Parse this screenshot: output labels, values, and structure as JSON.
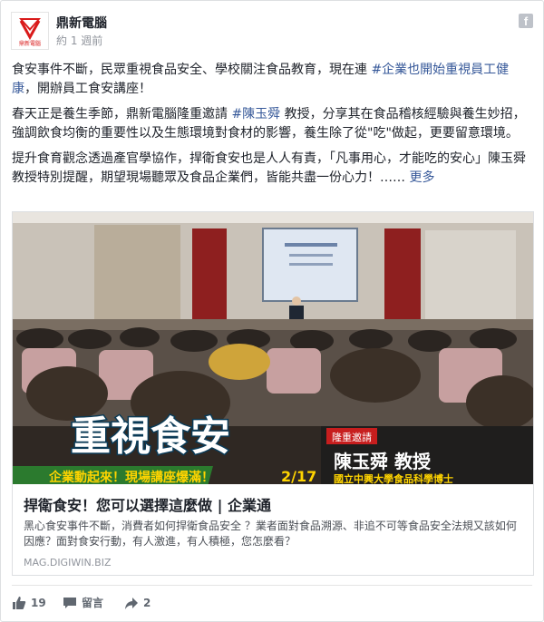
{
  "page": {
    "name": "鼎新電腦",
    "time": "約 1 週前",
    "logo_text": "鼎新電腦"
  },
  "post": {
    "p1_pre": "食安事件不斷，民眾重視食品安全、學校關注食品教育，現在連 ",
    "p1_hashtag": "#企業也開始重視員工健康",
    "p1_post": "，開辦員工食安講座！",
    "p2_pre": "春天正是養生季節，鼎新電腦隆重邀請 ",
    "p2_hashtag": "#陳玉舜",
    "p2_post": " 教授，分享其在食品稽核經驗與養生妙招，強調飲食均衡的重要性以及生態環境對食材的影響，養生除了從\"吃\"做起，更要留意環境。",
    "p3": "提升食育觀念透過產官學協作，捍衛食安也是人人有責，「凡事用心，才能吃的安心」陳玉舜教授特別提醒，期望現場聽眾及食品企業們，皆能共盡一份心力！…… ",
    "more_label": "更多"
  },
  "link_preview": {
    "image": {
      "headline": "重視食安",
      "banner": "企業動起來！現場講座爆滿！",
      "date": "2/17",
      "badge": "隆重邀請",
      "speaker": "陳玉舜 教授",
      "affiliation": "國立中興大學食品科學博士"
    },
    "title": "捍衛食安！您可以選擇這麼做 | 企業通",
    "description": "黑心食安事件不斷，消費者如何捍衛食品安全 ？業者面對食品溯源、非追不可等食品安全法規又該如何因應？面對食安行動，有人激進，有人積極，您怎麼看？",
    "domain": "MAG.DIGIWIN.BIZ"
  },
  "actions": {
    "like_count": "19",
    "comment_label": "留言",
    "share_count": "2"
  },
  "colors": {
    "link": "#365899",
    "accent_red": "#d91a1a",
    "banner_green": "#2b7a2e",
    "banner_yellow": "#ffd400"
  }
}
